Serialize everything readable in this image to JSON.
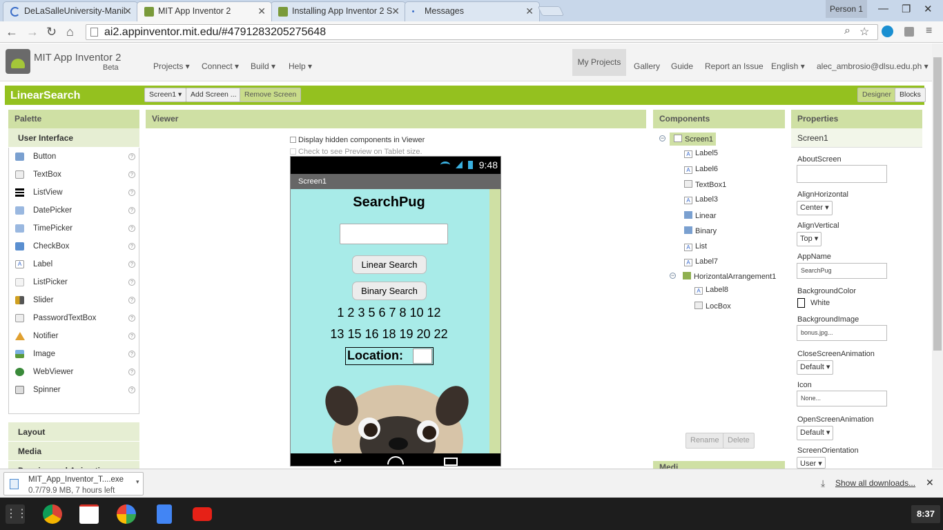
{
  "browser": {
    "tabs": [
      {
        "label": "DeLaSalleUniversity-Manil"
      },
      {
        "label": "MIT App Inventor 2"
      },
      {
        "label": "Installing App Inventor 2 S"
      },
      {
        "label": "Messages"
      }
    ],
    "profile": "Person 1",
    "url": "ai2.appinventor.mit.edu/#4791283205275648"
  },
  "header": {
    "title": "MIT App Inventor 2",
    "beta": "Beta",
    "menus": [
      "Projects ▾",
      "Connect ▾",
      "Build ▾",
      "Help ▾"
    ],
    "right_menus": [
      "My Projects",
      "Gallery",
      "Guide",
      "Report an Issue",
      "English ▾",
      "alec_ambrosio@dlsu.edu.ph ▾"
    ]
  },
  "toolbar": {
    "project": "LinearSearch",
    "screen_select": "Screen1 ▾",
    "add_screen": "Add Screen ...",
    "remove_screen": "Remove Screen",
    "designer": "Designer",
    "blocks": "Blocks"
  },
  "palette": {
    "title": "Palette",
    "category": "User Interface",
    "items": [
      "Button",
      "TextBox",
      "ListView",
      "DatePicker",
      "TimePicker",
      "CheckBox",
      "Label",
      "ListPicker",
      "Slider",
      "PasswordTextBox",
      "Notifier",
      "Image",
      "WebViewer",
      "Spinner"
    ],
    "help": "?",
    "other_categories": [
      "Layout",
      "Media",
      "Drawing and Animation"
    ]
  },
  "viewer": {
    "title": "Viewer",
    "hidden_check": "Display hidden components in Viewer",
    "tablet_check": "Check to see Preview on Tablet size.",
    "phone": {
      "time": "9:48",
      "screen_title": "Screen1",
      "app_label": "SearchPug",
      "btn_linear": "Linear Search",
      "btn_binary": "Binary Search",
      "numbers_1": "1 2 3 5 6 7 8 10 12",
      "numbers_2": "13 15 16 18 19 20 22",
      "location": "Location:"
    }
  },
  "components": {
    "title": "Components",
    "nodes": [
      "Screen1",
      "Label5",
      "Label6",
      "TextBox1",
      "Label3",
      "Linear",
      "Binary",
      "List",
      "Label7",
      "HorizontalArrangement1",
      "Label8",
      "LocBox"
    ],
    "rename": "Rename",
    "delete": "Delete",
    "media_partial": "Medi"
  },
  "properties": {
    "title": "Properties",
    "screen": "Screen1",
    "about_label": "AboutScreen",
    "alignh_label": "AlignHorizontal",
    "alignh_value": "Center ▾",
    "alignv_label": "AlignVertical",
    "alignv_value": "Top ▾",
    "appname_label": "AppName",
    "appname_value": "SearchPug",
    "bgcolor_label": "BackgroundColor",
    "bgcolor_value": "White",
    "bgimage_label": "BackgroundImage",
    "bgimage_value": "bonus.jpg...",
    "closeanim_label": "CloseScreenAnimation",
    "closeanim_value": "Default ▾",
    "icon_label": "Icon",
    "icon_value": "None...",
    "openanim_label": "OpenScreenAnimation",
    "openanim_value": "Default ▾",
    "orient_label": "ScreenOrientation",
    "orient_value": "User ▾"
  },
  "download": {
    "file": "MIT_App_Inventor_T....exe",
    "status": "0.7/79.9 MB, 7 hours left",
    "show_all": "Show all downloads..."
  },
  "taskbar": {
    "clock": "8:37"
  },
  "colors": {
    "accent_green": "#94c11f",
    "panel_header": "#cfe0a4",
    "phone_bg": "#a8ebe8"
  }
}
